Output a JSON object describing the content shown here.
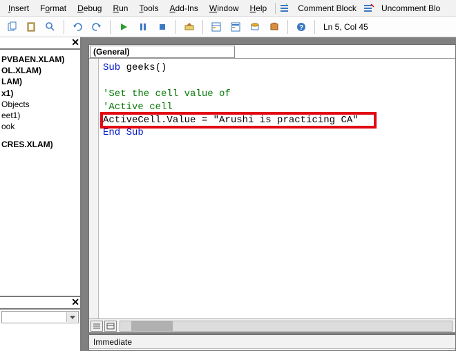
{
  "menu": {
    "insert": "Insert",
    "format": "Format",
    "debug": "Debug",
    "run": "Run",
    "tools": "Tools",
    "addins": "Add-Ins",
    "window": "Window",
    "help": "Help",
    "comment_block": "Comment Block",
    "uncomment_block": "Uncomment Blo"
  },
  "toolbar": {
    "cursor_pos": "Ln 5, Col 45"
  },
  "project_tree": {
    "n1": "PVBAEN.XLAM)",
    "n2": "OL.XLAM)",
    "n3": "LAM)",
    "n4": "x1)",
    "n5": "Objects",
    "n6": "eet1)",
    "n7": "ook",
    "n8": "CRES.XLAM)"
  },
  "code": {
    "object_combo": "(General)",
    "line1_kw": "Sub",
    "line1_rest": " geeks()",
    "line3": "'Set the cell value of",
    "line4": "'Active cell",
    "line5": "ActiveCell.Value = \"Arushi is practicing CA\"",
    "line6_kw": "End Sub"
  },
  "immediate": {
    "title": "Immediate"
  }
}
